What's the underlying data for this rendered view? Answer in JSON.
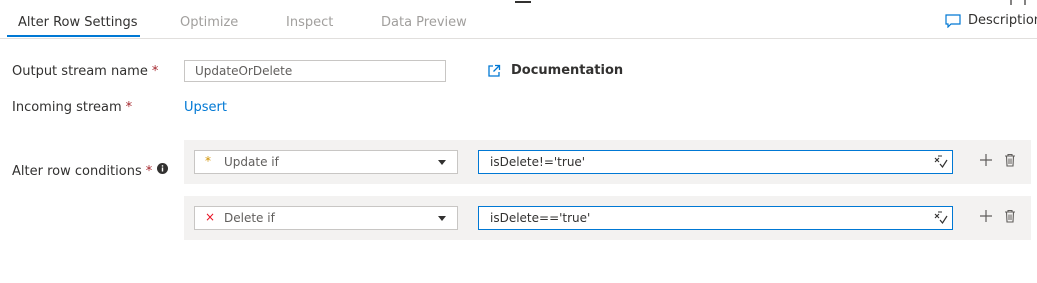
{
  "tabs": [
    {
      "label": "Alter Row Settings",
      "active": true
    },
    {
      "label": "Optimize",
      "active": false
    },
    {
      "label": "Inspect",
      "active": false
    },
    {
      "label": "Data Preview",
      "active": false
    }
  ],
  "description_label": "Description",
  "fields": {
    "output_stream_label": "Output stream name",
    "required_mark": "*",
    "output_stream_value": "UpdateOrDelete",
    "documentation_label": "Documentation",
    "incoming_stream_label": "Incoming stream",
    "incoming_stream_value": "Upsert",
    "conditions_label": "Alter row conditions"
  },
  "conditions": [
    {
      "icon": "*",
      "icon_name": "asterisk-icon",
      "icon_color": "#d29200",
      "type": "Update if",
      "expression": "isDelete!='true'"
    },
    {
      "icon": "×",
      "icon_name": "x-icon",
      "icon_color": "#e81123",
      "type": "Delete if",
      "expression": "isDelete=='true'"
    }
  ],
  "colors": {
    "accent": "#0078d4",
    "required": "#a4262c"
  }
}
